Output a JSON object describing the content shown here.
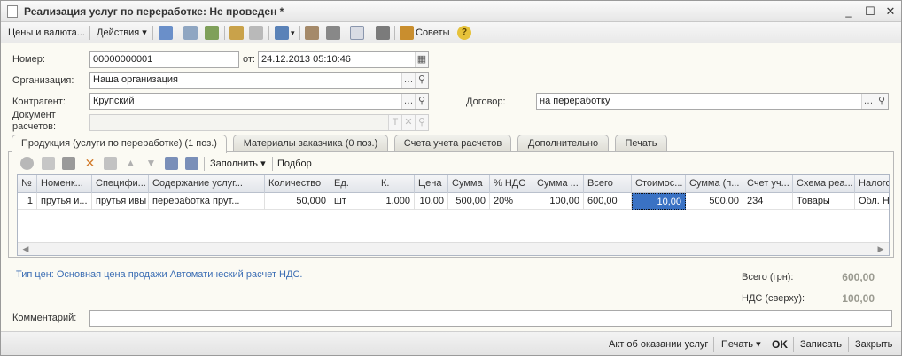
{
  "window": {
    "title": "Реализация услуг по переработке: Не проведен *",
    "minimize": "_",
    "maximize": "☐",
    "close": "✕"
  },
  "toolbar": {
    "prices_label": "Цены и валюта...",
    "actions_label": "Действия",
    "advice_label": "Советы"
  },
  "form": {
    "number_label": "Номер:",
    "number_value": "00000000001",
    "date_label": "от:",
    "date_value": "24.12.2013 05:10:46",
    "org_label": "Организация:",
    "org_value": "Наша организация",
    "contractor_label": "Контрагент:",
    "contractor_value": "Крупский",
    "contract_label": "Договор:",
    "contract_value": "на переработку",
    "doc_label_line1": "Документ",
    "doc_label_line2": "расчетов:",
    "doc_value": ""
  },
  "tabs": [
    {
      "label": "Продукция (услуги по переработке) (1 поз.)"
    },
    {
      "label": "Материалы заказчика (0 поз.)"
    },
    {
      "label": "Счета учета расчетов"
    },
    {
      "label": "Дополнительно"
    },
    {
      "label": "Печать"
    }
  ],
  "grid_toolbar": {
    "fill_label": "Заполнить",
    "select_label": "Подбор"
  },
  "grid": {
    "columns": [
      "№",
      "Номенк...",
      "Специфи...",
      "Содержание услуг...",
      "Количество",
      "Ед.",
      "К.",
      "Цена",
      "Сумма",
      "% НДС",
      "Сумма ...",
      "Всего",
      "Стоимос...",
      "Сумма (п...",
      "Счет уч...",
      "Схема реа...",
      "Налогов"
    ],
    "rows": [
      [
        "1",
        "прутья и...",
        "прутья ивы",
        "переработка прут...",
        "50,000",
        "шт",
        "1,000",
        "10,00",
        "500,00",
        "20%",
        "100,00",
        "600,00",
        "10,00",
        "500,00",
        "234",
        "Товары",
        "Обл. НДС"
      ]
    ]
  },
  "info": {
    "price_type_text": "Тип цен: Основная цена продажи Автоматический расчет НДС."
  },
  "totals": {
    "total_label": "Всего (грн):",
    "total_value": "600,00",
    "vat_label": "НДС (сверху):",
    "vat_value": "100,00"
  },
  "comment": {
    "label": "Комментарий:",
    "value": ""
  },
  "bottom_bar": {
    "act_label": "Акт об оказании услуг",
    "print_label": "Печать",
    "ok_label": "OK",
    "save_label": "Записать",
    "close_label": "Закрыть"
  },
  "colors": {
    "accent": "#3a72c4",
    "link": "#3c6eb4",
    "background": "#fbfaf3"
  }
}
